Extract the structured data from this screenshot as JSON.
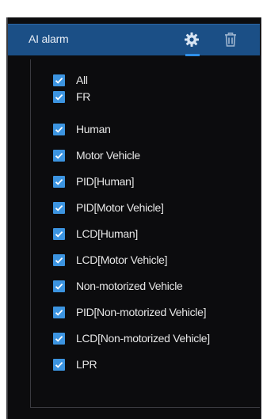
{
  "panel": {
    "title": "AI alarm",
    "settings_icon": "gear-icon",
    "delete_icon": "trash-icon"
  },
  "colors": {
    "header_bg": "#1b4f86",
    "panel_bg": "#0c0c0e",
    "checkbox": "#3c94e0",
    "active_tab_indicator": "#2f8fe8"
  },
  "items": [
    {
      "label": "All",
      "checked": true
    },
    {
      "label": "FR",
      "checked": true
    },
    {
      "label": "Human",
      "checked": true
    },
    {
      "label": "Motor Vehicle",
      "checked": true
    },
    {
      "label": "PID[Human]",
      "checked": true
    },
    {
      "label": "PID[Motor Vehicle]",
      "checked": true
    },
    {
      "label": "LCD[Human]",
      "checked": true
    },
    {
      "label": "LCD[Motor Vehicle]",
      "checked": true
    },
    {
      "label": "Non-motorized Vehicle",
      "checked": true
    },
    {
      "label": "PID[Non-motorized Vehicle]",
      "checked": true
    },
    {
      "label": "LCD[Non-motorized Vehicle]",
      "checked": true
    },
    {
      "label": "LPR",
      "checked": true
    }
  ]
}
